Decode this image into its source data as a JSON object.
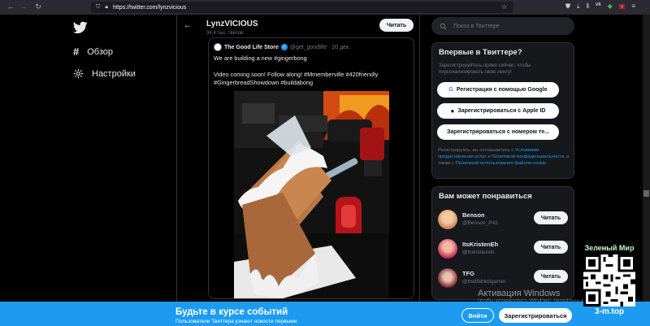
{
  "browser": {
    "url": "https://twitter.com/lynzvicious"
  },
  "left_nav": {
    "items": [
      {
        "label": "Обзор",
        "icon": "hashtag-icon"
      },
      {
        "label": "Настройки",
        "icon": "gear-icon"
      }
    ]
  },
  "profile": {
    "name": "LynzVICIOUS",
    "tweet_count": "34,4 тыс. твитов",
    "read_label": "Читать"
  },
  "quote_tweet": {
    "author_name": "The Good Life Store",
    "handle_date": "@get_goodlife · 20 дек.",
    "text_line1": "We are building a new #gingerbong",
    "text_line2": "",
    "text_line3": "Video coming soon! Follow along! #Mmemberville #420friendly",
    "text_line4": "#GingerbreadShowdown #buildabong"
  },
  "search": {
    "placeholder": "Поиск в Твиттере"
  },
  "signup_card": {
    "title": "Впервые в Твиттере?",
    "subtitle": "Зарегистрируйтесь прямо сейчас, чтобы персонализировать свою ленту!",
    "google_label": "Регистрация с помощью Google",
    "apple_label": "Зарегистрироваться с Apple ID",
    "phone_label": "Зарегистрироваться с номером те...",
    "legal_prefix": "Регистрируясь, вы соглашаетесь с ",
    "legal_terms": "Условиями предоставления услуг",
    "legal_and": " и ",
    "legal_privacy": "Политикой конфиденциальности",
    "legal_also": ", а также с ",
    "legal_cookies": "Политикой использования файлов cookie",
    "legal_end": "."
  },
  "suggestions": {
    "title": "Вам может понравиться",
    "items": [
      {
        "name": "Benson",
        "handle": "@Benson_P42",
        "button": "Читать"
      },
      {
        "name": "ItsKristenEh",
        "handle": "@itskristeneh",
        "button": "Читать"
      },
      {
        "name": "TFG",
        "handle": "@thatfabledgamer",
        "button": "Читать"
      }
    ]
  },
  "bottom_bar": {
    "title": "Будьте в курсе событий",
    "subtitle": "Пользователи Твиттера узнают новости первыми.",
    "login_label": "Войти",
    "register_label": "Зарегистрироваться"
  },
  "watermark": {
    "line1": "Активация Windows",
    "line2": "Чтобы активировать Windows, перейдите в раздел"
  },
  "overlay": {
    "title": "Зеленый Мир",
    "url": "3-m.top"
  },
  "colors": {
    "accent": "#1d9bf0",
    "background": "#000000",
    "card": "#16181c"
  }
}
